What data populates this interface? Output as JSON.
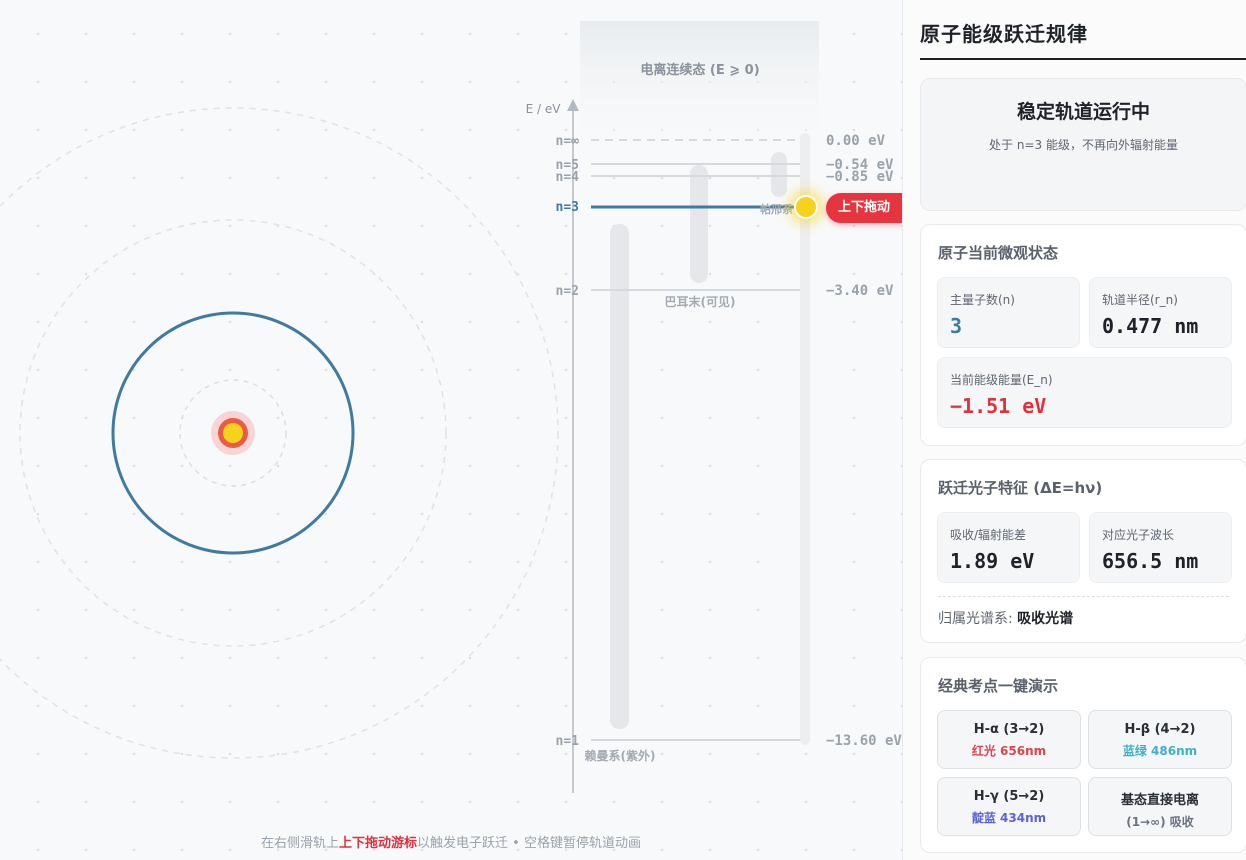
{
  "simulation": {
    "continuum_label": "电离连续态 (E ⩾ 0)",
    "axis_label": "E / eV",
    "levels": [
      {
        "n_label": "n=∞",
        "energy_label": "0.00 eV"
      },
      {
        "n_label": "n=5",
        "energy_label": "−0.54 eV"
      },
      {
        "n_label": "n=4",
        "energy_label": "−0.85 eV"
      },
      {
        "n_label": "n=3",
        "energy_label": ""
      },
      {
        "n_label": "n=2",
        "energy_label": "−3.40 eV"
      },
      {
        "n_label": "n=1",
        "energy_label": "−13.60 eV"
      }
    ],
    "series_labels": {
      "paschen": "帕邢系",
      "balmer": "巴耳末(可见)",
      "lyman": "赖曼系(紫外)"
    },
    "drag_label": "上下拖动",
    "hint_before": "在右侧滑轨上",
    "hint_highlight": "上下拖动游标",
    "hint_after": "以触发电子跃迁 • 空格键暂停轨道动画"
  },
  "panel": {
    "title": "原子能级跃迁规律",
    "status": {
      "title": "稳定轨道运行中",
      "desc": "处于 n=3 能级，不再向外辐射能量"
    },
    "micro": {
      "title": "原子当前微观状态",
      "n_label": "主量子数(n)",
      "n_value": "3",
      "r_label": "轨道半径(r_n)",
      "r_value": "0.477 nm",
      "e_label": "当前能级能量(E_n)",
      "e_value": "−1.51 eV"
    },
    "photon": {
      "title": "跃迁光子特征 (ΔE=hν)",
      "de_label": "吸收/辐射能差",
      "de_value": "1.89 eV",
      "wl_label": "对应光子波长",
      "wl_value": "656.5 nm",
      "spectrum_label": "归属光谱系:",
      "spectrum_value": "吸收光谱"
    },
    "demos": {
      "title": "经典考点一键演示",
      "buttons": [
        {
          "label": "H-α (3→2)",
          "sub": "红光 656nm",
          "color": "#e0434c"
        },
        {
          "label": "H-β (4→2)",
          "sub": "蓝绿 486nm",
          "color": "#3fb0c9"
        },
        {
          "label": "H-γ (5→2)",
          "sub": "靛蓝 434nm",
          "color": "#5a63d6"
        },
        {
          "label": "基态直接电离",
          "sub": "(1→∞) 吸收",
          "color": "#6b7280"
        }
      ]
    }
  },
  "colors": {
    "orbit": "#3f7aa0",
    "nucleus": "#f7d21c",
    "accent_red": "#e6353f"
  }
}
